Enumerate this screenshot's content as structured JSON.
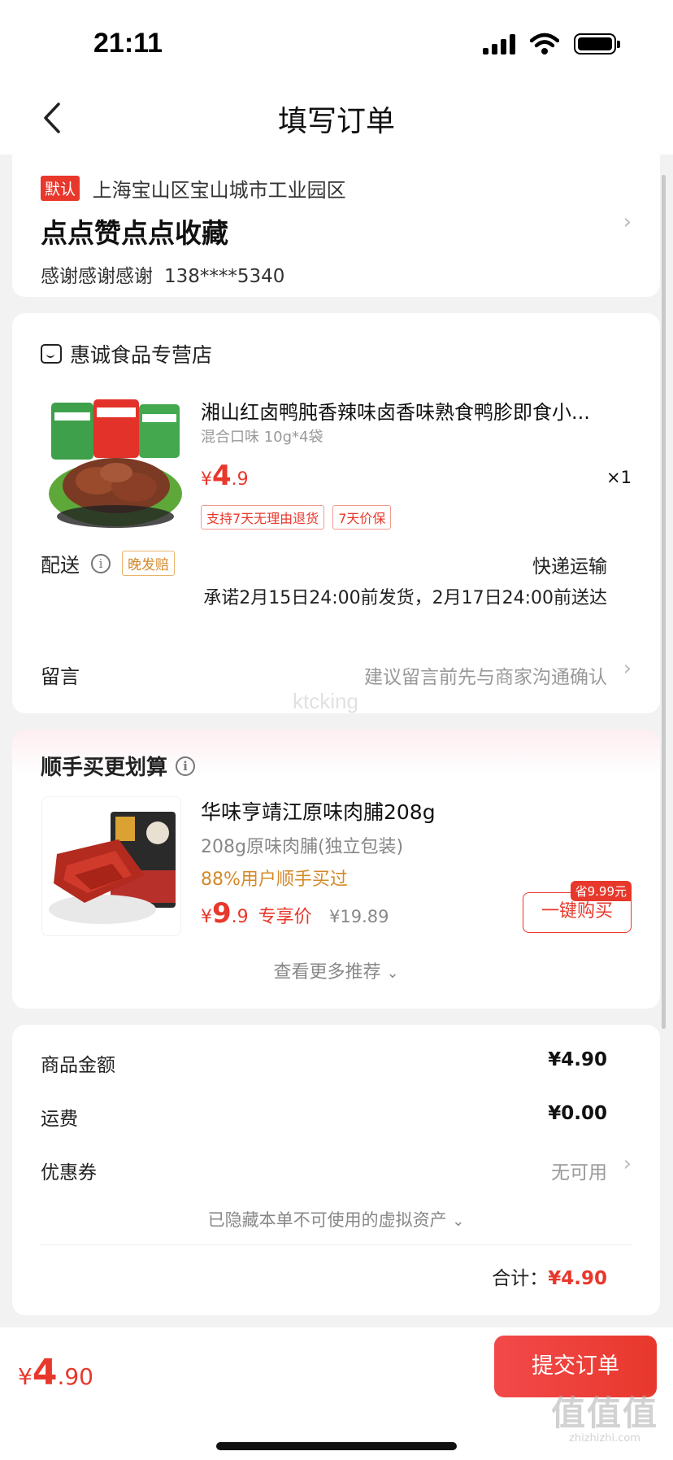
{
  "status_bar": {
    "time": "21:11"
  },
  "nav": {
    "title": "填写订单"
  },
  "address": {
    "default_tag": "默认",
    "region": "上海宝山区宝山城市工业园区",
    "detail": "点点赞点点收藏",
    "recipient": "感谢感谢感谢",
    "phone": "138****5340"
  },
  "shop": {
    "name": "惠诚食品专营店"
  },
  "product": {
    "title": "湘山红卤鸭肫香辣味卤香味熟食鸭胗即食小...",
    "spec": "混合口味 10g*4袋",
    "price_currency": "¥",
    "price_int": "4",
    "price_dec": ".9",
    "qty": "×1",
    "tags": [
      "支持7天无理由退货",
      "7天价保"
    ]
  },
  "delivery": {
    "label": "配送",
    "late_tag": "晚发赔",
    "type": "快递运输",
    "promise": "承诺2月15日24:00前发货，2月17日24:00前送达"
  },
  "message": {
    "label": "留言",
    "hint": "建议留言前先与商家沟通确认"
  },
  "watermark": "ktcking",
  "recommend": {
    "title": "顺手买更划算",
    "name": "华味亨靖江原味肉脯208g",
    "spec": "208g原味肉脯(独立包装)",
    "bought": "88%用户顺手买过",
    "price_currency": "¥",
    "price_int": "9",
    "price_dec": ".9",
    "price_label": "专享价",
    "orig_price": "¥19.89",
    "save_badge": "省9.99元",
    "buy_label": "一键购买",
    "more_label": "查看更多推荐"
  },
  "summary": {
    "goods_label": "商品金额",
    "goods_value": "¥4.90",
    "freight_label": "运费",
    "freight_value": "¥0.00",
    "coupon_label": "优惠券",
    "coupon_value": "无可用",
    "hidden_assets": "已隐藏本单不可使用的虚拟资产",
    "total_label": "合计：",
    "total_value": "¥4.90"
  },
  "bottom": {
    "price_currency": "¥",
    "price_int": "4",
    "price_dec": ".90",
    "submit_label": "提交订单",
    "brand_mark": "值值值",
    "brand_url": "zhizhizhi.com"
  },
  "colors": {
    "accent": "#e8382c",
    "warning": "#d38a2a",
    "background": "#f2f2f2"
  }
}
